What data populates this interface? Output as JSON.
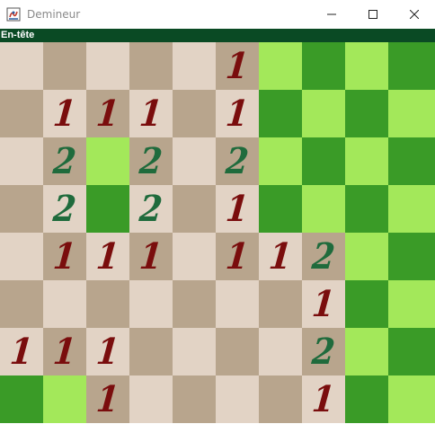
{
  "window": {
    "title": "Demineur"
  },
  "header": {
    "label": "En-tête"
  },
  "colors": {
    "revealed_light": "#e2d3c5",
    "revealed_dark": "#b8a58d",
    "hidden_light": "#a3e85a",
    "hidden_dark": "#3a9b27",
    "number_1": "#7a0d0d",
    "number_2": "#1f6b3c",
    "header_bg": "#0a4a24"
  },
  "board": {
    "rows": 8,
    "cols": 10,
    "grid": [
      [
        "",
        "",
        "",
        "",
        "",
        "1",
        "#",
        "#",
        "#",
        "#"
      ],
      [
        "",
        "1",
        "1",
        "1",
        "",
        "1",
        "#",
        "#",
        "#",
        "#"
      ],
      [
        "",
        "2",
        "#",
        "2",
        "",
        "2",
        "#",
        "#",
        "#",
        "#"
      ],
      [
        "",
        "2",
        "#",
        "2",
        "",
        "1",
        "#",
        "#",
        "#",
        "#"
      ],
      [
        "",
        "1",
        "1",
        "1",
        "",
        "1",
        "1",
        "2",
        "#",
        "#"
      ],
      [
        "",
        "",
        "",
        "",
        "",
        "",
        "",
        "1",
        "#",
        "#"
      ],
      [
        "1",
        "1",
        "1",
        "",
        "",
        "",
        "",
        "2",
        "#",
        "#"
      ],
      [
        "#",
        "#",
        "1",
        "",
        "",
        "",
        "",
        "1",
        "#",
        "#"
      ]
    ]
  }
}
